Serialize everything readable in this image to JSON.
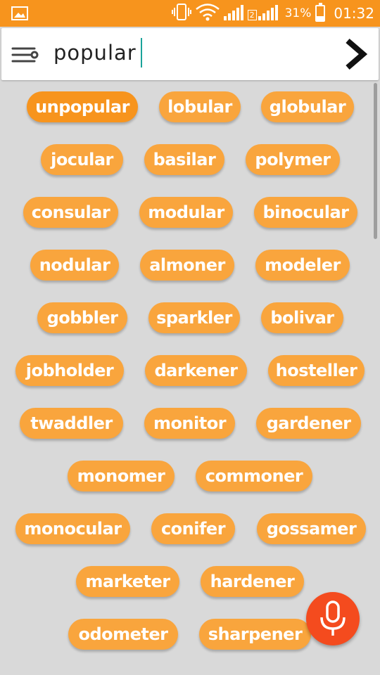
{
  "status_bar": {
    "battery_text": "31%",
    "battery_level": 0.31,
    "time": "01:32",
    "sim2_label": "2"
  },
  "search": {
    "query": "popular"
  },
  "suggestions": [
    "unpopular",
    "lobular",
    "globular",
    "jocular",
    "basilar",
    "polymer",
    "consular",
    "modular",
    "binocular",
    "nodular",
    "almoner",
    "modeler",
    "gobbler",
    "sparkler",
    "bolivar",
    "jobholder",
    "darkener",
    "hosteller",
    "twaddler",
    "monitor",
    "gardener",
    "monomer",
    "commoner",
    "monocular",
    "conifer",
    "gossamer",
    "marketer",
    "hardener",
    "odometer",
    "sharpener"
  ],
  "colors": {
    "accent": "#f7941d",
    "chip": "#f9a53d",
    "mic": "#f44b1e",
    "background": "#d9d9d9"
  },
  "icons": {
    "filter": "filter-icon",
    "go": "chevron-right-icon",
    "mic": "microphone-icon"
  }
}
